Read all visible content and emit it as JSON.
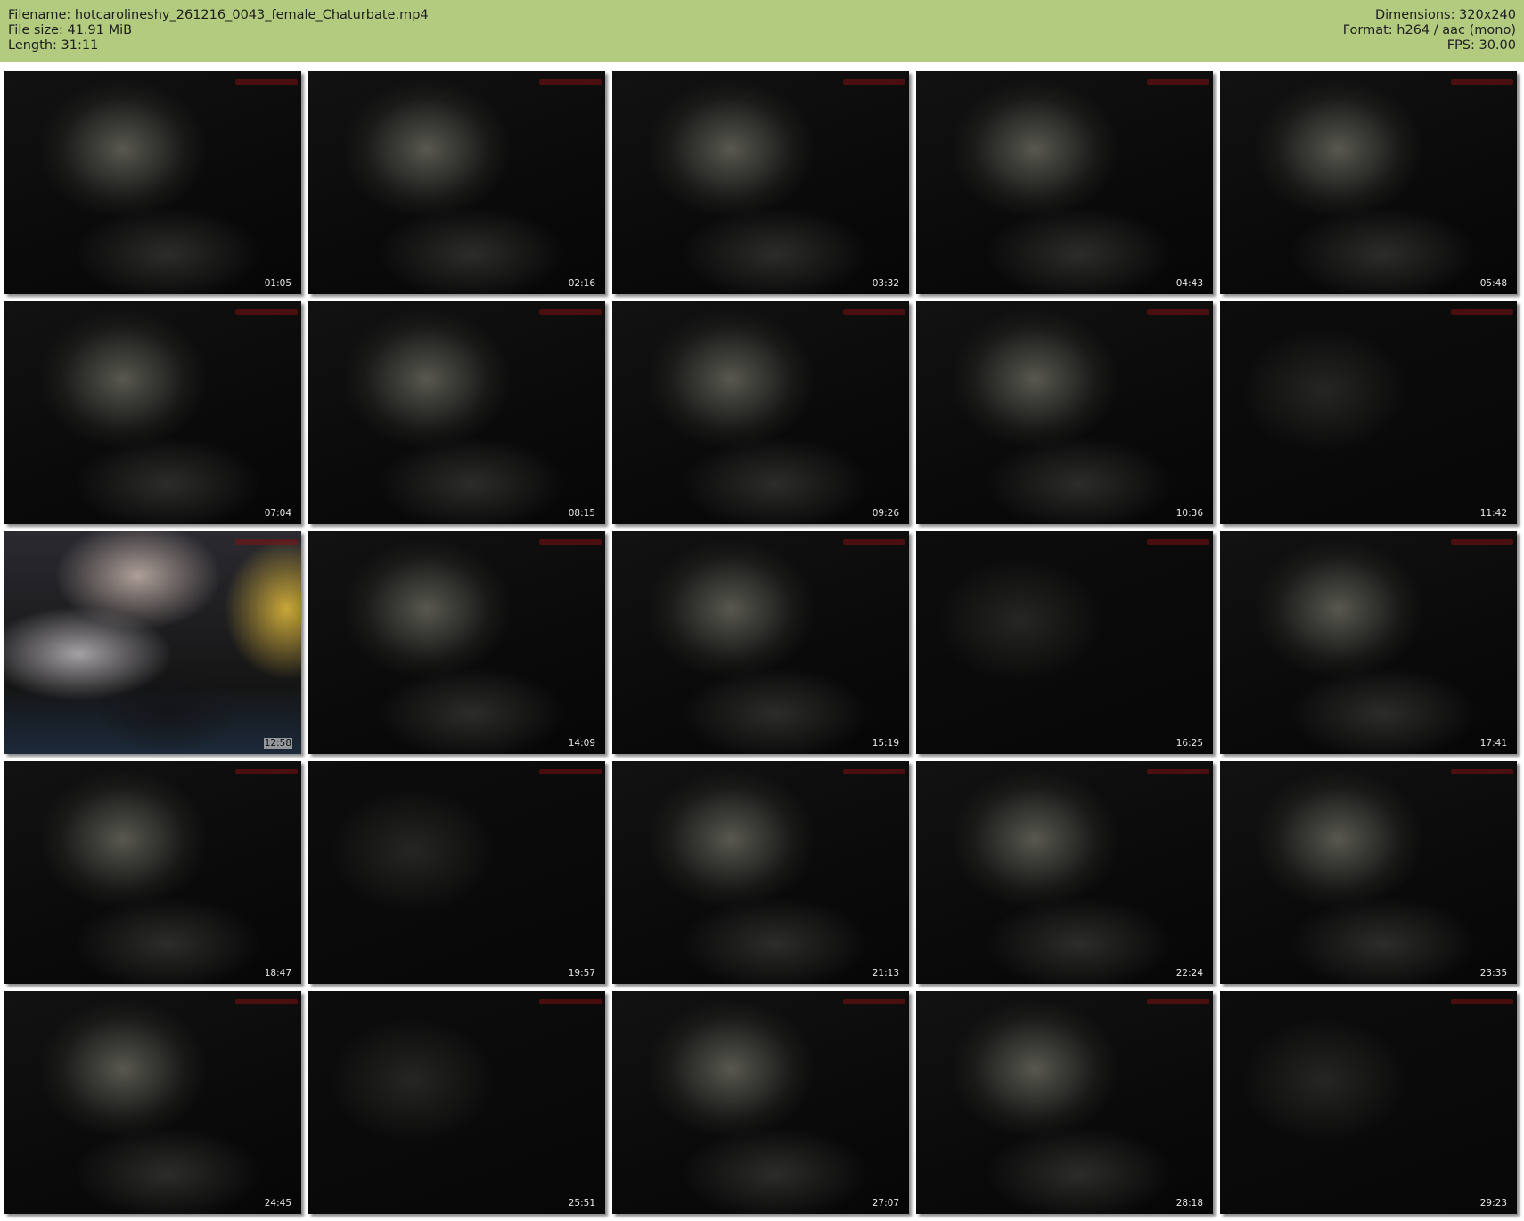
{
  "header": {
    "filename": "Filename: hotcarolineshy_261216_0043_female_Chaturbate.mp4",
    "file_size": "File size: 41.91 MiB",
    "length": "Length: 31:11",
    "dimensions": "Dimensions: 320x240",
    "format": "Format: h264 / aac (mono)",
    "fps": "FPS: 30.00"
  },
  "thumbnails": [
    {
      "time": "01:05",
      "style": "normal"
    },
    {
      "time": "02:16",
      "style": "normal"
    },
    {
      "time": "03:32",
      "style": "normal"
    },
    {
      "time": "04:43",
      "style": "normal"
    },
    {
      "time": "05:48",
      "style": "normal"
    },
    {
      "time": "07:04",
      "style": "normal"
    },
    {
      "time": "08:15",
      "style": "normal"
    },
    {
      "time": "09:26",
      "style": "normal"
    },
    {
      "time": "10:36",
      "style": "normal"
    },
    {
      "time": "11:42",
      "style": "dim"
    },
    {
      "time": "12:58",
      "style": "warm"
    },
    {
      "time": "14:09",
      "style": "normal"
    },
    {
      "time": "15:19",
      "style": "normal"
    },
    {
      "time": "16:25",
      "style": "dim"
    },
    {
      "time": "17:41",
      "style": "normal"
    },
    {
      "time": "18:47",
      "style": "normal"
    },
    {
      "time": "19:57",
      "style": "dim"
    },
    {
      "time": "21:13",
      "style": "normal"
    },
    {
      "time": "22:24",
      "style": "normal"
    },
    {
      "time": "23:35",
      "style": "normal"
    },
    {
      "time": "24:45",
      "style": "normal"
    },
    {
      "time": "25:51",
      "style": "dim"
    },
    {
      "time": "27:07",
      "style": "normal"
    },
    {
      "time": "28:18",
      "style": "normal"
    },
    {
      "time": "29:23",
      "style": "dim"
    }
  ],
  "colors": {
    "header_bg": "#b3cb7f",
    "page_bg": "#ffffff",
    "watermark": "#8a1010"
  }
}
